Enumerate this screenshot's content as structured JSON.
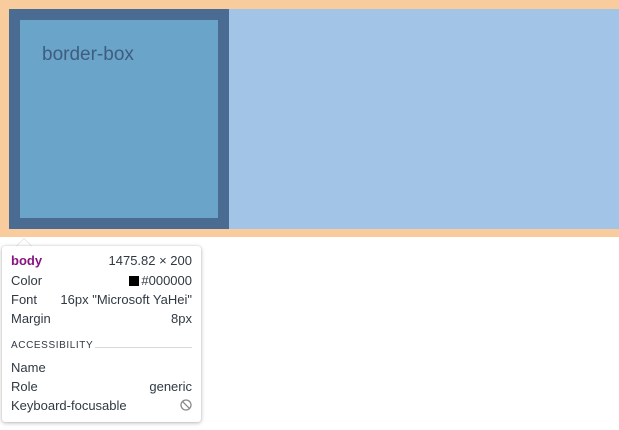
{
  "page": {
    "box_label": "border-box"
  },
  "colors": {
    "margin": "#f9cc9d",
    "content": "#a1c4e7",
    "border": "#4a6b92",
    "padding_box": "#6aa4c9",
    "element_tag": "#881280"
  },
  "tooltip": {
    "element": "body",
    "size": "1475.82 × 200",
    "rows": [
      {
        "label": "Color",
        "value": "#000000"
      },
      {
        "label": "Font",
        "value": "16px \"Microsoft YaHei\""
      },
      {
        "label": "Margin",
        "value": "8px"
      }
    ],
    "section_title": "ACCESSIBILITY",
    "accessibility": [
      {
        "label": "Name",
        "value": ""
      },
      {
        "label": "Role",
        "value": "generic"
      },
      {
        "label": "Keyboard-focusable",
        "icon": "not-focusable-icon"
      }
    ]
  }
}
